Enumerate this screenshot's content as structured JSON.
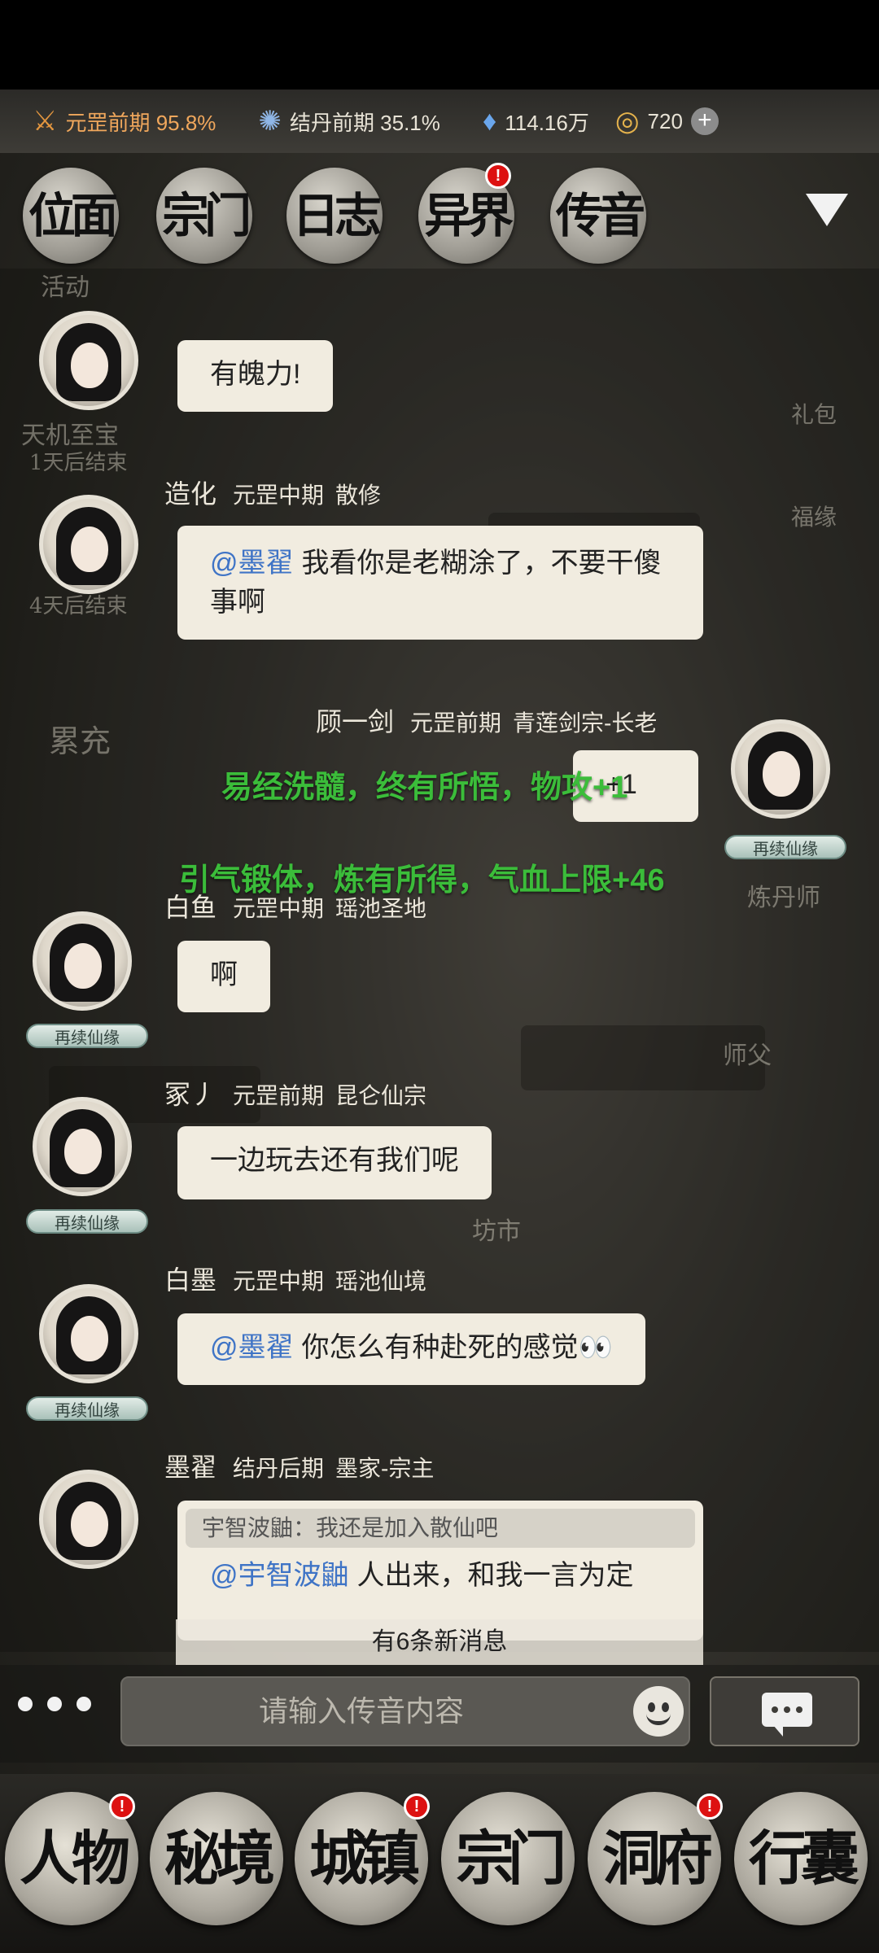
{
  "status": {
    "realm": "元罡前期 95.8%",
    "core": "结丹前期 35.1%",
    "spirit_stones": "114.16万",
    "gold": "720"
  },
  "tabs": [
    {
      "label": "位面",
      "badge": false
    },
    {
      "label": "宗门",
      "badge": false
    },
    {
      "label": "日志",
      "badge": false
    },
    {
      "label": "异界",
      "badge": true
    },
    {
      "label": "传音",
      "badge": false
    }
  ],
  "background_labels": {
    "activity": "活动",
    "tianji": "天机至宝",
    "tianji_end": "1天后结束",
    "end4": "4天后结束",
    "recharge": "累充",
    "gift": "礼包",
    "fortune": "福缘",
    "alchemist": "炼丹师",
    "master": "师父",
    "market": "坊市"
  },
  "messages": [
    {
      "text": "有魄力!"
    },
    {
      "name": "造化",
      "rank": "元罡中期",
      "sect": "散修",
      "mention": "@墨翟",
      "text": "我看你是老糊涂了，不要干傻事啊"
    },
    {
      "name": "顾一剑",
      "rank": "元罡前期",
      "sect": "青莲剑宗-长老",
      "text": "+1",
      "ribbon": "再续仙缘"
    },
    {
      "name": "白鱼",
      "rank": "元罡中期",
      "sect": "瑶池圣地",
      "text": "啊",
      "ribbon": "再续仙缘"
    },
    {
      "name": "冢丿",
      "rank": "元罡前期",
      "sect": "昆仑仙宗",
      "text": "一边玩去还有我们呢",
      "ribbon": "再续仙缘"
    },
    {
      "name": "白墨",
      "rank": "元罡中期",
      "sect": "瑶池仙境",
      "mention": "@墨翟",
      "text": "你怎么有种赴死的感觉👀",
      "ribbon": "再续仙缘"
    },
    {
      "name": "墨翟",
      "rank": "结丹后期",
      "sect": "墨家-宗主",
      "quote": "宇智波鼬：我还是加入散仙吧",
      "mention": "@宇智波鼬",
      "text": "人出来，和我一言为定"
    }
  ],
  "toasts": [
    "易经洗髓，终有所悟，物攻+1",
    "引气锻体，炼有所得，气血上限+46"
  ],
  "new_messages": "有6条新消息",
  "input": {
    "placeholder": "请输入传音内容"
  },
  "bottom_nav": [
    {
      "label": "人物",
      "badge": true
    },
    {
      "label": "秘境",
      "badge": false
    },
    {
      "label": "城镇",
      "badge": true
    },
    {
      "label": "宗门",
      "badge": false
    },
    {
      "label": "洞府",
      "badge": true
    },
    {
      "label": "行囊",
      "badge": false
    }
  ]
}
